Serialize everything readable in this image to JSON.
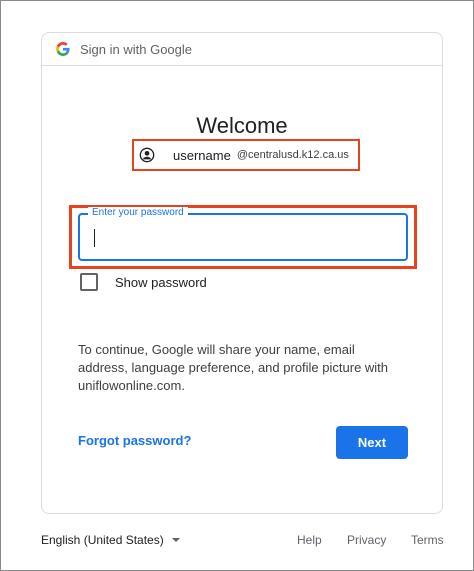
{
  "card": {
    "header_title": "Sign in with Google",
    "welcome": "Welcome",
    "account": {
      "username": "username",
      "domain": "@centralusd.k12.ca.us"
    },
    "password": {
      "label": "Enter your password",
      "value": ""
    },
    "show_password_label": "Show password",
    "consent_text": "To continue, Google will share your name, email address, language preference, and profile picture with uniflowonline.com.",
    "forgot_password": "Forgot password?",
    "next_label": "Next"
  },
  "footer": {
    "language": "English (United States)",
    "links": [
      "Help",
      "Privacy",
      "Terms"
    ]
  },
  "colors": {
    "accent": "#1a73e8",
    "highlight": "#e8431f"
  },
  "icons": {
    "header_logo": "google-g-icon",
    "account": "account-circle-icon",
    "language_dropdown": "chevron-down-icon"
  }
}
